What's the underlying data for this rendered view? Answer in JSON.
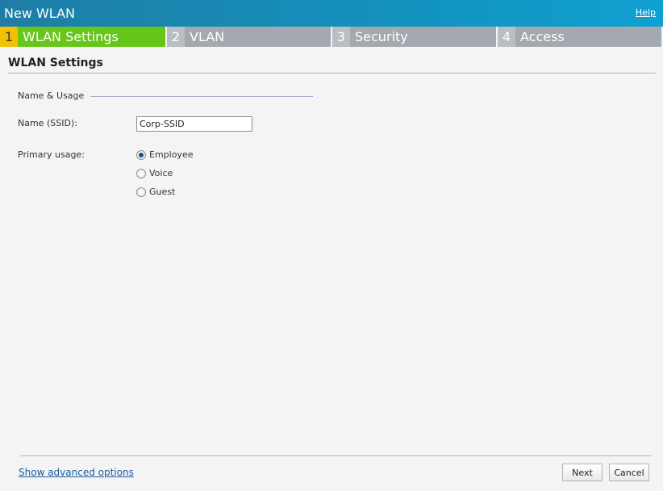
{
  "window": {
    "title": "New WLAN",
    "help_label": "Help"
  },
  "steps": [
    {
      "number": "1",
      "label": "WLAN Settings",
      "active": true
    },
    {
      "number": "2",
      "label": "VLAN",
      "active": false
    },
    {
      "number": "3",
      "label": "Security",
      "active": false
    },
    {
      "number": "4",
      "label": "Access",
      "active": false
    }
  ],
  "section": {
    "title": "WLAN Settings",
    "group_legend": "Name & Usage"
  },
  "ssid": {
    "label": "Name (SSID):",
    "value": "Corp-SSID"
  },
  "usage": {
    "label": "Primary usage:",
    "options": [
      "Employee",
      "Voice",
      "Guest"
    ],
    "selected": "Employee"
  },
  "footer": {
    "advanced_link": "Show advanced options",
    "next_label": "Next",
    "cancel_label": "Cancel"
  },
  "colors": {
    "title_bar": "#1392be",
    "active_step": "#66c61a",
    "active_step_number": "#f2c200",
    "inactive_step": "#a3a9ae",
    "link": "#1a5a9c"
  }
}
